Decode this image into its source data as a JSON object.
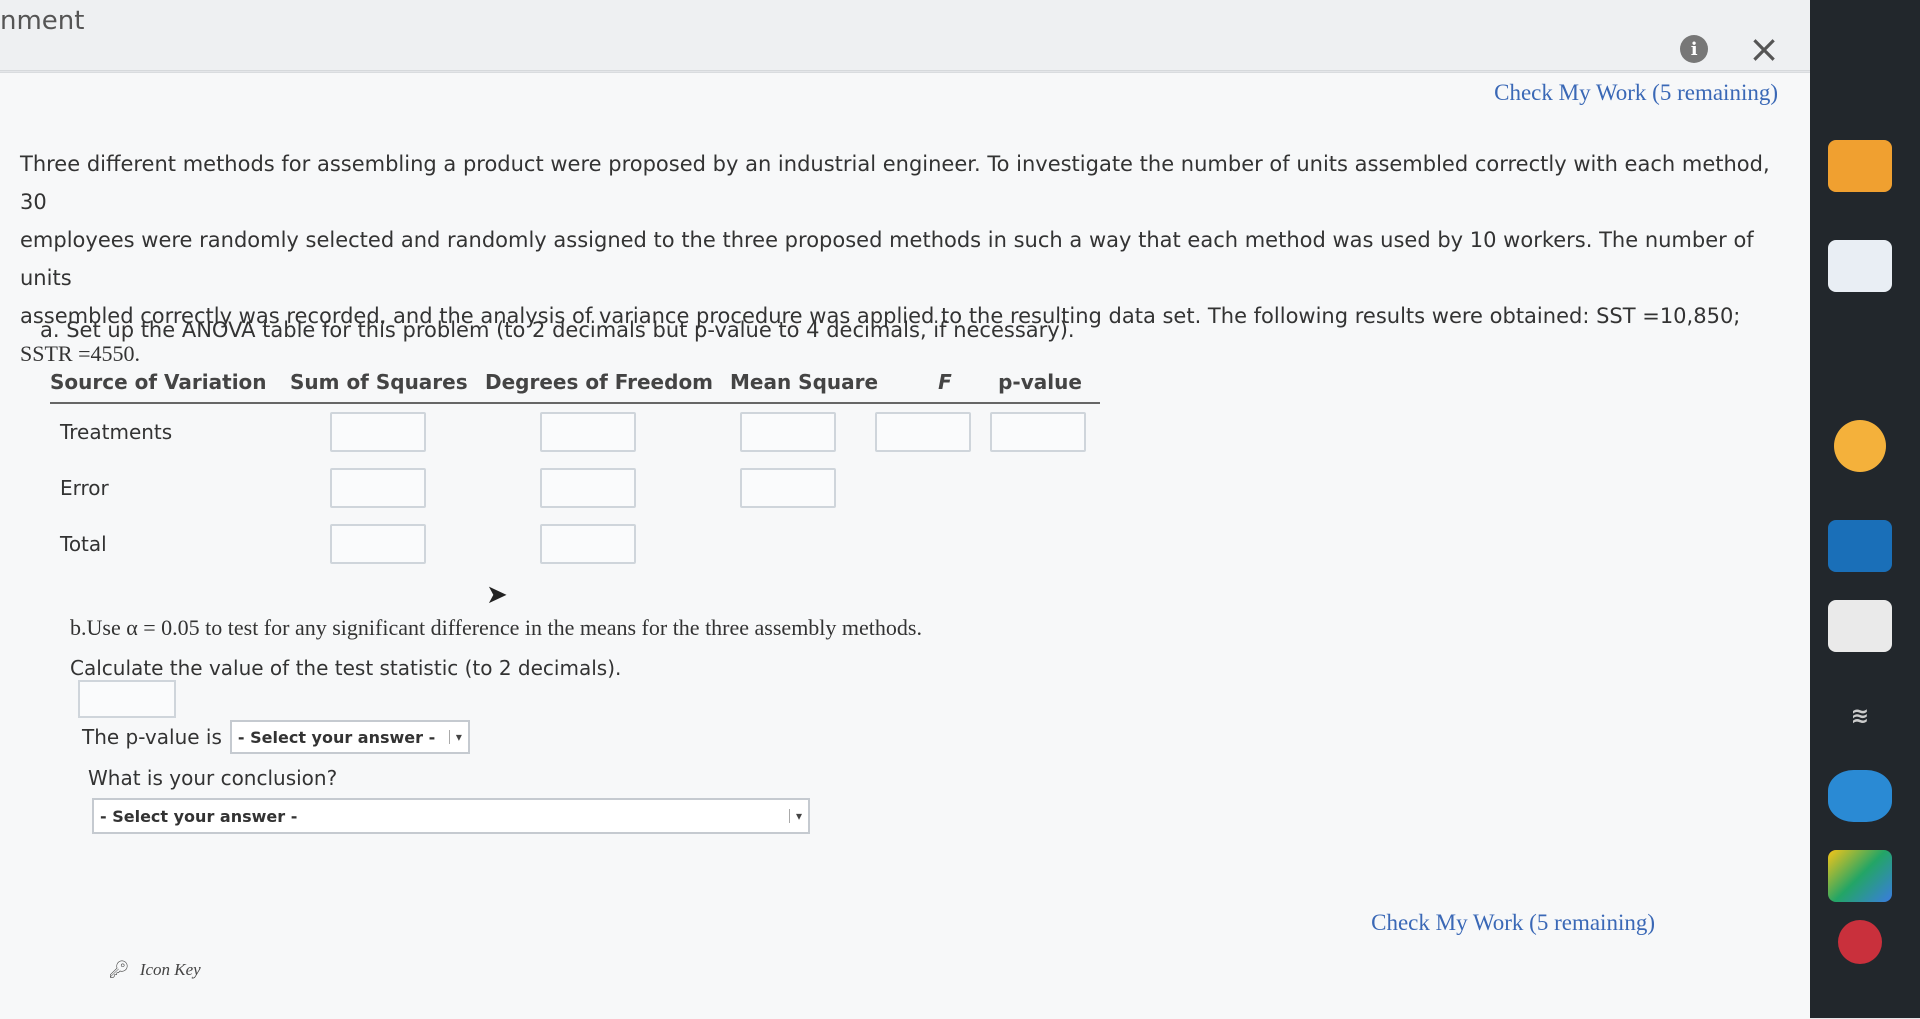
{
  "header": {
    "title_fragment": "nment",
    "info_label": "i",
    "close_label": "×"
  },
  "check_my_work": {
    "top": "Check My Work (5 remaining)",
    "bottom": "Check My Work (5 remaining)"
  },
  "problem": {
    "line1": "Three different methods for assembling a product were proposed by an industrial engineer. To investigate the number of units assembled correctly with each method, 30",
    "line2": "employees were randomly selected and randomly assigned to the three proposed methods in such a way that each method was used by 10 workers. The number of units",
    "line3": "assembled correctly was recorded, and the analysis of variance procedure was applied to the resulting data set. The following results were obtained: SST =10,850;",
    "line4": "SSTR =4550."
  },
  "part_a": {
    "question": "a. Set up the ANOVA table for this problem (to 2 decimals but p-value to 4 decimals, if necessary).",
    "headers": {
      "source": "Source of Variation",
      "ss": "Sum of Squares",
      "df": "Degrees of Freedom",
      "ms": "Mean Square",
      "f": "F",
      "p": "p-value"
    },
    "rows": {
      "treatments": "Treatments",
      "error": "Error",
      "total": "Total"
    }
  },
  "part_b": {
    "line1": "b.Use α = 0.05 to test for any significant difference in the means for the three assembly methods.",
    "line2": "Calculate the value of the test statistic (to 2 decimals).",
    "pvalue_label": "The p-value is",
    "pvalue_select": "- Select your answer -",
    "conclusion_question": "What is your conclusion?",
    "conclusion_select": "- Select your answer -"
  },
  "footer": {
    "icon_key": "Icon Key"
  },
  "colors": {
    "link": "#3a68b6",
    "taskbar": "#22272c"
  }
}
